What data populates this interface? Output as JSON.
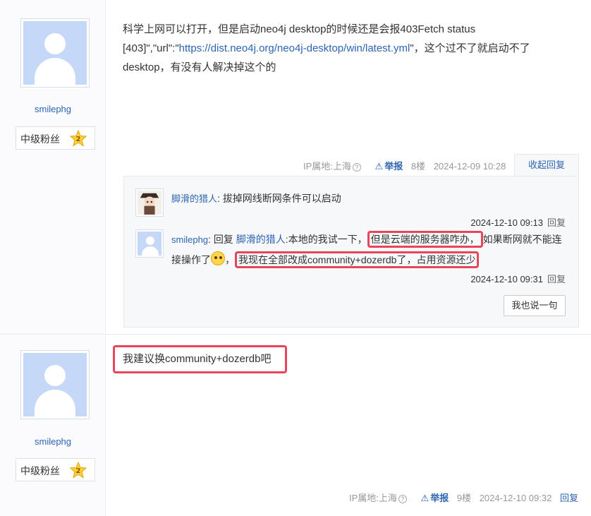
{
  "posts": [
    {
      "author": {
        "name": "smilephg",
        "badge_label": "中级粉丝",
        "badge_level": "2"
      },
      "content": {
        "text_before": "科学上网可以打开，但是启动neo4j desktop的时候还是会报403Fetch status [403]\",\"url\":\"",
        "link": "https://dist.neo4j.org/neo4j-desktop/win/latest.yml",
        "text_after": "\"，这个过不了就启动不了desktop，有没有人解决掉这个的"
      },
      "tail": {
        "ip": "IP属地:上海",
        "report": "举报",
        "floor": "8楼",
        "time": "2024-12-09 10:28",
        "action": "收起回复"
      },
      "replies": [
        {
          "name": "脚滑的猎人",
          "text": "拔掉网线断网条件可以启动",
          "time": "2024-12-10 09:13",
          "reply": "回复"
        },
        {
          "name": "smilephg",
          "reply_prefix": "回复",
          "reply_to": "脚滑的猎人",
          "text_1": ":本地的我试一下，",
          "hl_1": "但是云端的服务器咋办，",
          "text_2": "如果断网就不能连接操作了",
          "text_3": "，",
          "hl_2": "我现在全部改成community+dozerdb了，占用资源还少",
          "time": "2024-12-10 09:31",
          "reply": "回复"
        }
      ],
      "say_button": "我也说一句"
    },
    {
      "author": {
        "name": "smilephg",
        "badge_label": "中级粉丝",
        "badge_level": "2"
      },
      "content": {
        "text": "我建议换community+dozerdb吧"
      },
      "tail": {
        "ip": "IP属地:上海",
        "report": "举报",
        "floor": "9楼",
        "time": "2024-12-10 09:32",
        "action": "回复"
      }
    }
  ],
  "colors": {
    "link": "#2d64b3",
    "highlight": "#e8455a",
    "avatar_bg": "#c5d8f8"
  }
}
